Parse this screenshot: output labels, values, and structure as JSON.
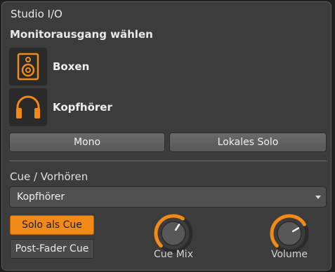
{
  "title": "Studio I/O",
  "monitor": {
    "heading": "Monitorausgang wählen",
    "outputs": [
      {
        "label": "Boxen",
        "icon": "speaker-icon"
      },
      {
        "label": "Kopfhörer",
        "icon": "headphones-icon"
      }
    ],
    "mono_label": "Mono",
    "local_solo_label": "Lokales Solo"
  },
  "cue": {
    "heading": "Cue / Vorhören",
    "selected_output": "Kopfhörer",
    "solo_as_cue_label": "Solo als Cue",
    "post_fader_label": "Post-Fader Cue",
    "cue_mix_label": "Cue Mix",
    "cue_mix_level": 0.62,
    "volume_label": "Volume",
    "volume_level": 0.72
  },
  "colors": {
    "accent": "#f28a17",
    "panel_bg": "#3c3c3c",
    "icon_bg": "#2a2a2a"
  }
}
